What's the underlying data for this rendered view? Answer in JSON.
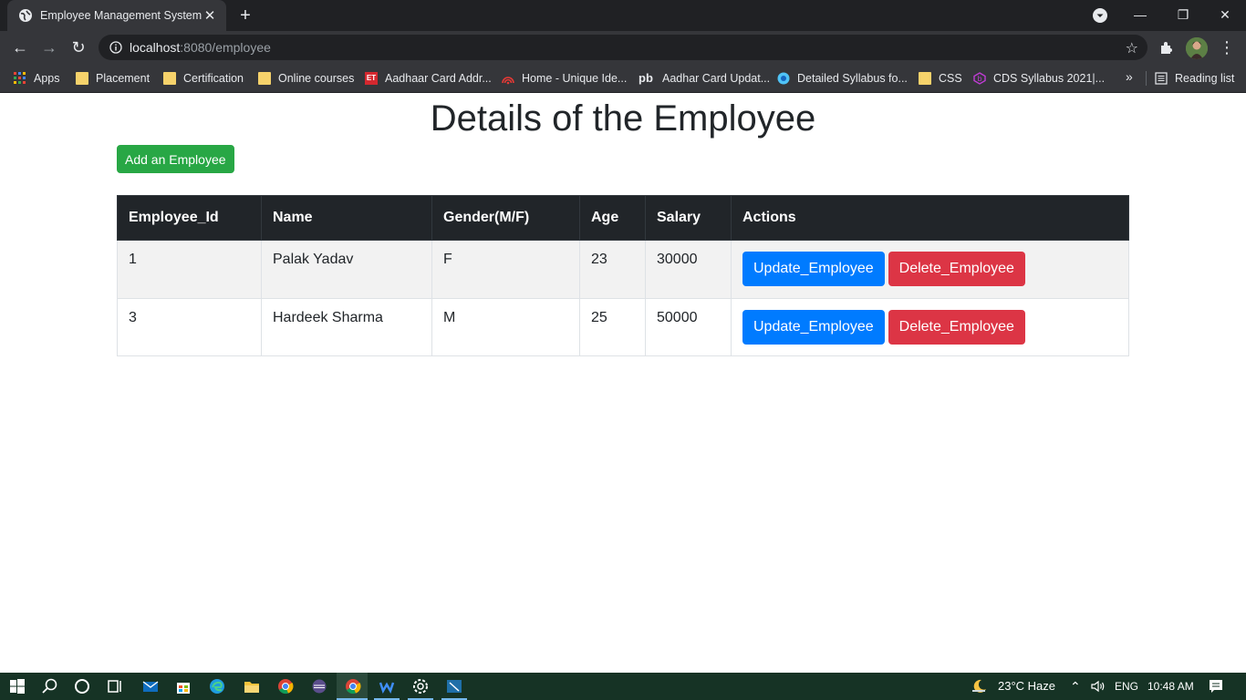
{
  "browser": {
    "tab_title": "Employee Management System",
    "url_host": "localhost",
    "url_path": ":8080/employee",
    "bookmarks": [
      {
        "label": "Apps",
        "icon": "apps-grid-icon"
      },
      {
        "label": "Placement",
        "icon": "folder-icon"
      },
      {
        "label": "Certification",
        "icon": "folder-icon"
      },
      {
        "label": "Online courses",
        "icon": "folder-icon"
      },
      {
        "label": "Aadhaar Card Addr...",
        "icon": "et-icon"
      },
      {
        "label": "Home - Unique Ide...",
        "icon": "uidai-icon"
      },
      {
        "label": "Aadhar Card Updat...",
        "icon": "pb-icon"
      },
      {
        "label": "Detailed Syllabus fo...",
        "icon": "globe-icon"
      },
      {
        "label": "CSS",
        "icon": "folder-icon"
      },
      {
        "label": "CDS Syllabus 2021|...",
        "icon": "b-icon"
      }
    ],
    "more_bookmarks": "»",
    "reading_list": "Reading list",
    "et_badge": "ET",
    "pb_badge": "pb"
  },
  "page": {
    "title": "Details of the Employee",
    "add_button": "Add an Employee",
    "table": {
      "headers": [
        "Employee_Id",
        "Name",
        "Gender(M/F)",
        "Age",
        "Salary",
        "Actions"
      ],
      "rows": [
        {
          "id": "1",
          "name": "Palak Yadav",
          "gender": "F",
          "age": "23",
          "salary": "30000"
        },
        {
          "id": "3",
          "name": "Hardeek Sharma",
          "gender": "M",
          "age": "25",
          "salary": "50000"
        }
      ],
      "update_label": "Update_Employee",
      "delete_label": "Delete_Employee"
    }
  },
  "taskbar": {
    "weather": "23°C  Haze",
    "language": "ENG",
    "time": "10:48 AM"
  },
  "colors": {
    "add_button": "#28a745",
    "update_button": "#007bff",
    "delete_button": "#dc3545",
    "table_header": "#212529"
  }
}
